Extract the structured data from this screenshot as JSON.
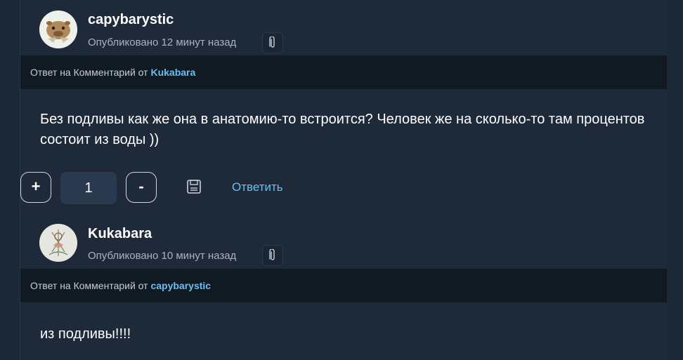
{
  "comments": [
    {
      "username": "capybarystic",
      "published": "Опубликовано 12 минут назад",
      "reply_to_prefix": "Ответ на Комментарий от",
      "reply_to_author": "Kukabara",
      "text": "Без подливы как же она в анатомию-то встроится? Человек же на сколько-то там процентов состоит из воды ))",
      "avatar_icon": "capybara-avatar",
      "actions": {
        "plus_label": "+",
        "score": "1",
        "minus_label": "-",
        "save_icon": "floppy-disk-icon",
        "reply_label": "Ответить"
      }
    },
    {
      "username": "Kukabara",
      "published": "Опубликовано 10 минут назад",
      "reply_to_prefix": "Ответ на Комментарий от",
      "reply_to_author": "capybarystic",
      "text": "из подливы!!!!",
      "avatar_icon": "sketch-figure-avatar"
    }
  ],
  "pin_icon": "paperclip-icon",
  "colors": {
    "background": "#1b2838",
    "card": "#1e2a3a",
    "reply_bar": "#111922",
    "link": "#66c0f4",
    "text": "#ffffff",
    "muted": "#aab3bf"
  }
}
